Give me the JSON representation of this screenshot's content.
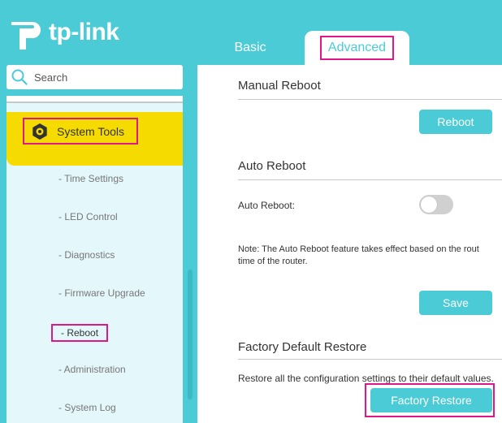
{
  "header": {
    "logo_text": "tp-link",
    "tabs": [
      {
        "label": "Basic",
        "active": false
      },
      {
        "label": "Advanced",
        "active": true
      }
    ]
  },
  "colors": {
    "accent": "#4acbd6",
    "highlight": "#e0168b",
    "selected": "#f5db00"
  },
  "search": {
    "placeholder": "Search",
    "icon": "search-icon"
  },
  "sidebar": {
    "section": {
      "label": "System Tools",
      "icon": "gear-icon"
    },
    "items": [
      {
        "label": "- Time Settings"
      },
      {
        "label": "- LED Control"
      },
      {
        "label": "- Diagnostics"
      },
      {
        "label": "- Firmware Upgrade"
      },
      {
        "label": "- Reboot",
        "selected": true
      },
      {
        "label": "- Administration"
      },
      {
        "label": "- System Log"
      }
    ]
  },
  "main": {
    "manual_reboot": {
      "title": "Manual Reboot",
      "button": "Reboot"
    },
    "auto_reboot": {
      "title": "Auto Reboot",
      "label": "Auto Reboot:",
      "toggle_on": false,
      "note_line1": "Note: The Auto Reboot feature takes effect based on the rout",
      "note_line2": "time of the router.",
      "save_button": "Save"
    },
    "factory_restore": {
      "title": "Factory Default Restore",
      "description": "Restore all the configuration settings to their default values.",
      "button": "Factory Restore"
    }
  }
}
